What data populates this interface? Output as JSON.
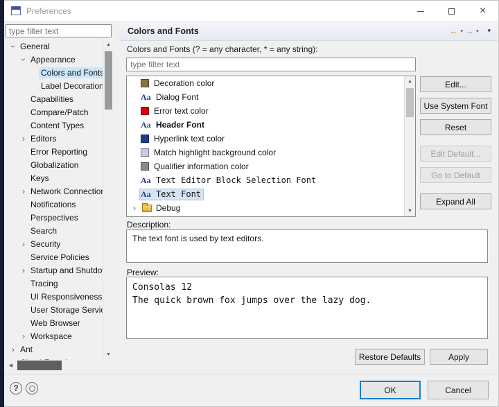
{
  "colors": {
    "accent": "#0078d7",
    "tree_selection": "#cbe6f9",
    "list_selection": "#d5e3f2",
    "strip": "#141c33"
  },
  "icons": {
    "help": "?",
    "back": "←",
    "forward": "→",
    "menu_caret": "▾",
    "chevron": "›",
    "scroll_up": "▲",
    "scroll_down": "▼",
    "scroll_left": "◀",
    "close": "×",
    "font_sample": "Aa"
  },
  "window": {
    "title": "Preferences"
  },
  "sidebar": {
    "filter_placeholder": "type filter text",
    "items": [
      {
        "label": "General",
        "indent": 0,
        "chevron": "expanded",
        "selected": false
      },
      {
        "label": "Appearance",
        "indent": 1,
        "chevron": "expanded",
        "selected": false
      },
      {
        "label": "Colors and Fonts",
        "indent": 2,
        "chevron": "none",
        "selected": true
      },
      {
        "label": "Label Decorations",
        "indent": 2,
        "chevron": "none",
        "selected": false
      },
      {
        "label": "Capabilities",
        "indent": 1,
        "chevron": "none",
        "selected": false
      },
      {
        "label": "Compare/Patch",
        "indent": 1,
        "chevron": "none",
        "selected": false
      },
      {
        "label": "Content Types",
        "indent": 1,
        "chevron": "none",
        "selected": false
      },
      {
        "label": "Editors",
        "indent": 1,
        "chevron": "collapsed",
        "selected": false
      },
      {
        "label": "Error Reporting",
        "indent": 1,
        "chevron": "none",
        "selected": false
      },
      {
        "label": "Globalization",
        "indent": 1,
        "chevron": "none",
        "selected": false
      },
      {
        "label": "Keys",
        "indent": 1,
        "chevron": "none",
        "selected": false
      },
      {
        "label": "Network Connections",
        "indent": 1,
        "chevron": "collapsed",
        "selected": false
      },
      {
        "label": "Notifications",
        "indent": 1,
        "chevron": "none",
        "selected": false
      },
      {
        "label": "Perspectives",
        "indent": 1,
        "chevron": "none",
        "selected": false
      },
      {
        "label": "Search",
        "indent": 1,
        "chevron": "none",
        "selected": false
      },
      {
        "label": "Security",
        "indent": 1,
        "chevron": "collapsed",
        "selected": false
      },
      {
        "label": "Service Policies",
        "indent": 1,
        "chevron": "none",
        "selected": false
      },
      {
        "label": "Startup and Shutdown",
        "indent": 1,
        "chevron": "collapsed",
        "selected": false
      },
      {
        "label": "Tracing",
        "indent": 1,
        "chevron": "none",
        "selected": false
      },
      {
        "label": "UI Responsiveness",
        "indent": 1,
        "chevron": "none",
        "selected": false
      },
      {
        "label": "User Storage Service",
        "indent": 1,
        "chevron": "none",
        "selected": false
      },
      {
        "label": "Web Browser",
        "indent": 1,
        "chevron": "none",
        "selected": false
      },
      {
        "label": "Workspace",
        "indent": 1,
        "chevron": "collapsed",
        "selected": false
      },
      {
        "label": "Ant",
        "indent": 0,
        "chevron": "collapsed",
        "selected": false
      },
      {
        "label": "Cloud Foundry",
        "indent": 0,
        "chevron": "collapsed",
        "selected": false
      }
    ]
  },
  "header": {
    "title": "Colors and Fonts"
  },
  "main": {
    "filter_label": "Colors and Fonts (? = any character, * = any string):",
    "filter_placeholder": "type filter text",
    "list": [
      {
        "label": "Decoration color",
        "type": "swatch",
        "color": "#8a7148",
        "bold": false,
        "mono": false,
        "selected": false
      },
      {
        "label": "Dialog Font",
        "type": "font",
        "bold": false,
        "mono": false,
        "selected": false
      },
      {
        "label": "Error text color",
        "type": "swatch",
        "color": "#dd0000",
        "bold": false,
        "mono": false,
        "selected": false
      },
      {
        "label": "Header Font",
        "type": "font",
        "bold": true,
        "mono": false,
        "selected": false
      },
      {
        "label": "Hyperlink text color",
        "type": "swatch",
        "color": "#1a3e8e",
        "bold": false,
        "mono": false,
        "selected": false
      },
      {
        "label": "Match highlight background color",
        "type": "swatch",
        "color": "#cdc7ec",
        "bold": false,
        "mono": false,
        "selected": false
      },
      {
        "label": "Qualifier information color",
        "type": "swatch",
        "color": "#8a8a8a",
        "bold": false,
        "mono": false,
        "selected": false
      },
      {
        "label": "Text Editor Block Selection Font",
        "type": "font",
        "bold": false,
        "mono": true,
        "selected": false
      },
      {
        "label": "Text Font",
        "type": "font",
        "bold": false,
        "mono": true,
        "selected": true
      },
      {
        "label": "Debug",
        "type": "category",
        "bold": false,
        "mono": false,
        "selected": false
      }
    ],
    "side_buttons": [
      {
        "label": "Edit...",
        "enabled": true
      },
      {
        "label": "Use System Font",
        "enabled": true
      },
      {
        "label": "Reset",
        "enabled": true
      },
      {
        "label": "Edit Default...",
        "enabled": false
      },
      {
        "label": "Go to Default",
        "enabled": false
      },
      {
        "label": "Expand All",
        "enabled": true
      }
    ],
    "description_label": "Description:",
    "description_text": "The text font is used by text editors.",
    "preview_label": "Preview:",
    "preview_lines": [
      "Consolas 12",
      "The quick brown fox jumps over the lazy dog."
    ],
    "restore_defaults_label": "Restore Defaults",
    "apply_label": "Apply"
  },
  "footer": {
    "ok_label": "OK",
    "cancel_label": "Cancel"
  }
}
